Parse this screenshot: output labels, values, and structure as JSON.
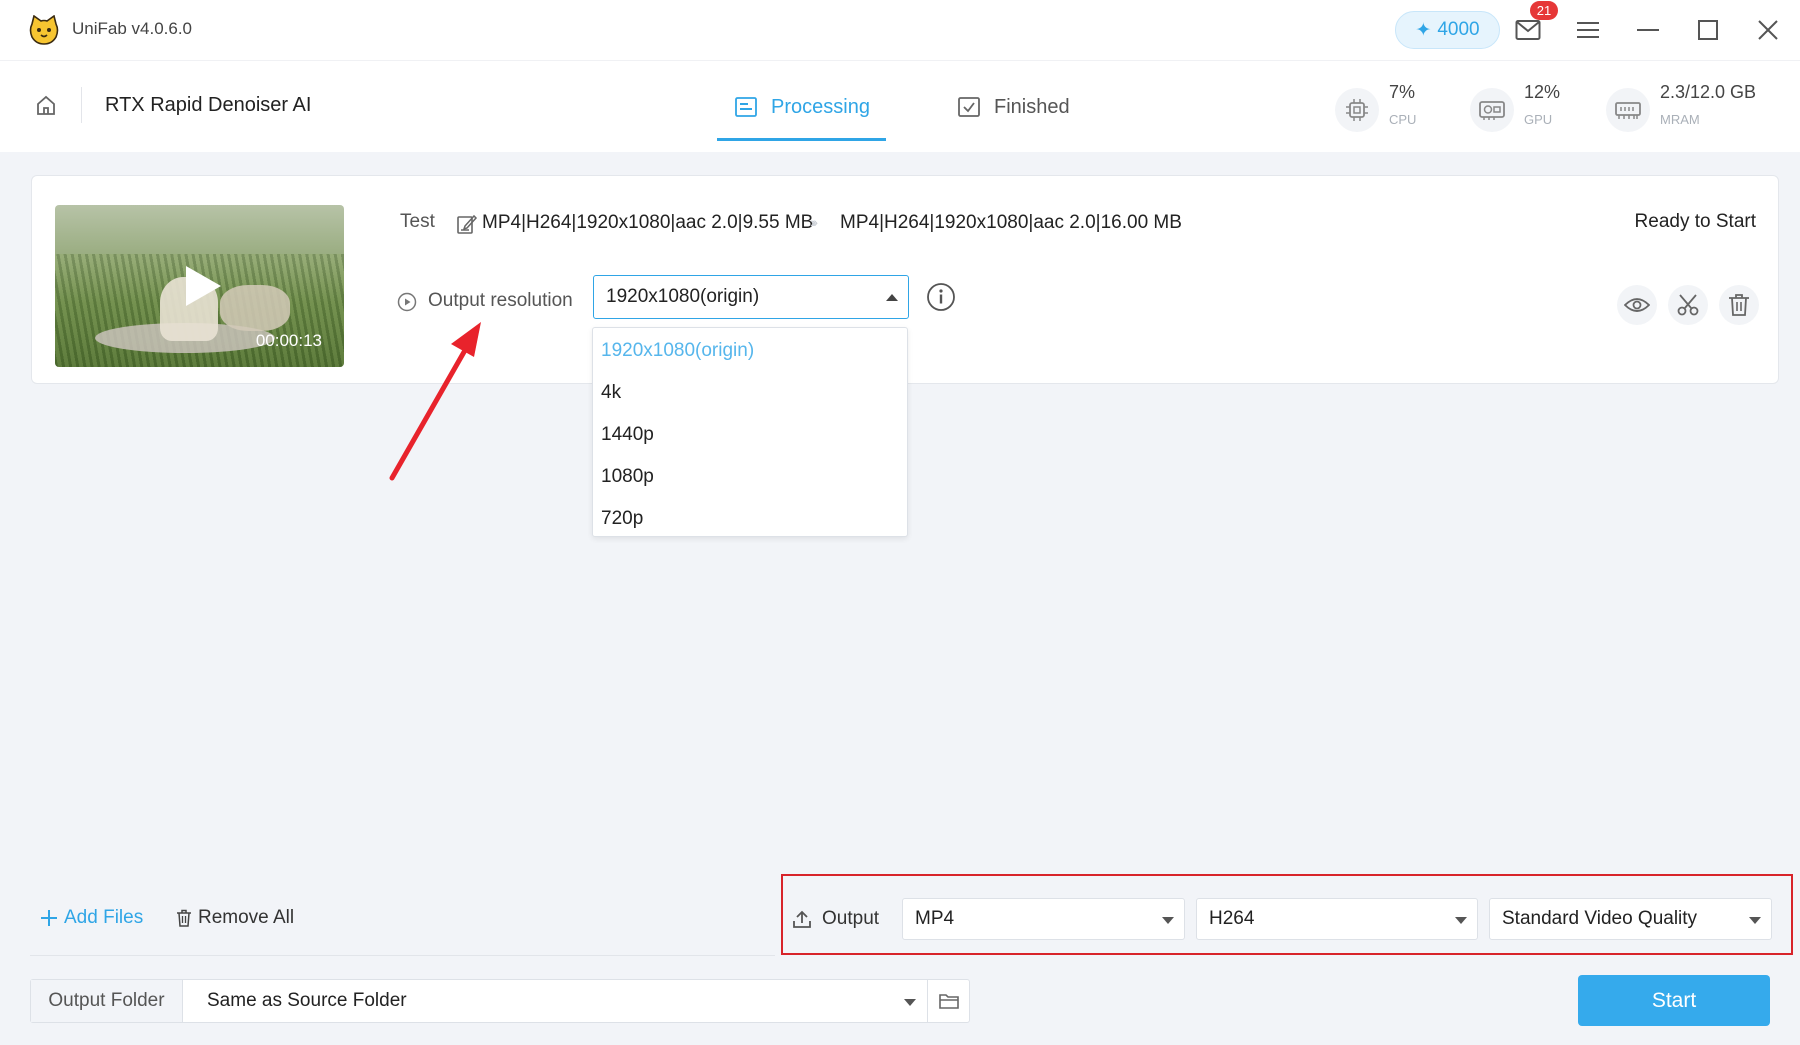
{
  "app": {
    "title": "UniFab v4.0.6.0",
    "credits": "4000",
    "mail_badge": "21"
  },
  "toolbar": {
    "tool_title": "RTX Rapid Denoiser AI",
    "tabs": [
      {
        "label": "Processing",
        "active": true
      },
      {
        "label": "Finished",
        "active": false
      }
    ],
    "stats": [
      {
        "value": "7%",
        "label": "CPU",
        "icon": "cpu-icon"
      },
      {
        "value": "12%",
        "label": "GPU",
        "icon": "gpu-icon"
      },
      {
        "value": "2.3/12.0 GB",
        "label": "MRAM",
        "icon": "memory-icon"
      }
    ]
  },
  "task": {
    "name": "Test",
    "duration": "00:00:13",
    "source_info": "MP4|H264|1920x1080|aac 2.0|9.55 MB",
    "target_info": "MP4|H264|1920x1080|aac 2.0|16.00 MB",
    "status": "Ready to Start",
    "resolution_label": "Output resolution",
    "resolution_value": "1920x1080(origin)",
    "resolution_options": [
      {
        "label": "1920x1080(origin)",
        "selected": true
      },
      {
        "label": "4k",
        "selected": false
      },
      {
        "label": "1440p",
        "selected": false
      },
      {
        "label": "1080p",
        "selected": false
      },
      {
        "label": "720p",
        "selected": false
      }
    ]
  },
  "bottom": {
    "add_files": "Add Files",
    "remove_all": "Remove All",
    "output_label": "Output",
    "format": "MP4",
    "codec": "H264",
    "quality": "Standard Video Quality",
    "output_folder_label": "Output Folder",
    "output_folder_value": "Same as Source Folder",
    "start": "Start"
  },
  "colors": {
    "accent": "#2fa5e6",
    "annotation": "#d8232a",
    "badge": "#e63737"
  }
}
